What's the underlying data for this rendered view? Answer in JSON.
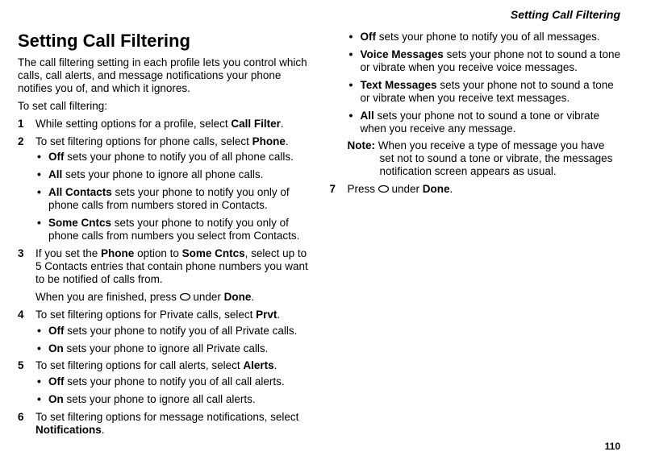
{
  "running_header": "Setting Call Filtering",
  "page_number": "110",
  "h1": "Setting Call Filtering",
  "intro": "The call filtering setting in each profile lets you control which calls, call alerts, and message notifications your phone notifies you of, and which it ignores.",
  "prompt": "To set call filtering:",
  "steps": [
    {
      "num": "1",
      "parts": [
        "While setting options for a profile, select ",
        {
          "b": "Call Filter"
        },
        "."
      ]
    },
    {
      "num": "2",
      "parts": [
        "To set filtering options for phone calls, select ",
        {
          "b": "Phone"
        },
        "."
      ],
      "sub": [
        [
          {
            "b": "Off"
          },
          " sets your phone to notify you of all phone calls."
        ],
        [
          {
            "b": "All"
          },
          " sets your phone to ignore all phone calls."
        ],
        [
          {
            "b": "All Contacts"
          },
          " sets your phone to notify you only of phone calls from numbers stored in Contacts."
        ],
        [
          {
            "b": "Some Cntcs"
          },
          " sets your phone to notify you only of phone calls from numbers you select from Contacts."
        ]
      ]
    },
    {
      "num": "3",
      "parts": [
        "If you set the ",
        {
          "b": "Phone"
        },
        " option to ",
        {
          "b": "Some Cntcs"
        },
        ", select up to 5 Contacts entries that contain phone numbers you want to be notified of calls from."
      ],
      "extra": {
        "pre": "When you are finished, press ",
        "icon": true,
        "mid": " under ",
        "bold": "Done",
        "post": "."
      }
    },
    {
      "num": "4",
      "parts": [
        "To set filtering options for Private calls, select ",
        {
          "b": "Prvt"
        },
        "."
      ],
      "sub": [
        [
          {
            "b": "Off"
          },
          " sets your phone to notify you of all Private calls."
        ],
        [
          {
            "b": "On"
          },
          " sets your phone to ignore all Private calls."
        ]
      ]
    },
    {
      "num": "5",
      "parts": [
        "To set filtering options for call alerts, select ",
        {
          "b": "Alerts"
        },
        "."
      ],
      "sub": [
        [
          {
            "b": "Off"
          },
          " sets your phone to notify you of all call alerts."
        ],
        [
          {
            "b": "On"
          },
          " sets your phone to ignore all call alerts."
        ]
      ]
    },
    {
      "num": "6",
      "parts": [
        "To set filtering options for message notifications, select ",
        {
          "b": "Notifications"
        },
        "."
      ],
      "sub": [
        [
          {
            "b": "Off"
          },
          " sets your phone to notify you of all messages."
        ],
        [
          {
            "b": "Voice Messages"
          },
          " sets your phone not to sound a tone or vibrate when you receive voice messages."
        ],
        [
          {
            "b": "Text Messages"
          },
          " sets your phone not to sound a tone or vibrate when you receive text messages."
        ],
        [
          {
            "b": "All"
          },
          " sets your phone not to sound a tone or vibrate when you receive any message."
        ]
      ],
      "note": {
        "label": "Note:",
        "text": " When you receive a type of message you have set not to sound a tone or vibrate, the messages notification screen appears as usual."
      }
    },
    {
      "num": "7",
      "parts": [
        "Press ",
        {
          "icon": true
        },
        " under ",
        {
          "b": "Done"
        },
        "."
      ]
    }
  ]
}
